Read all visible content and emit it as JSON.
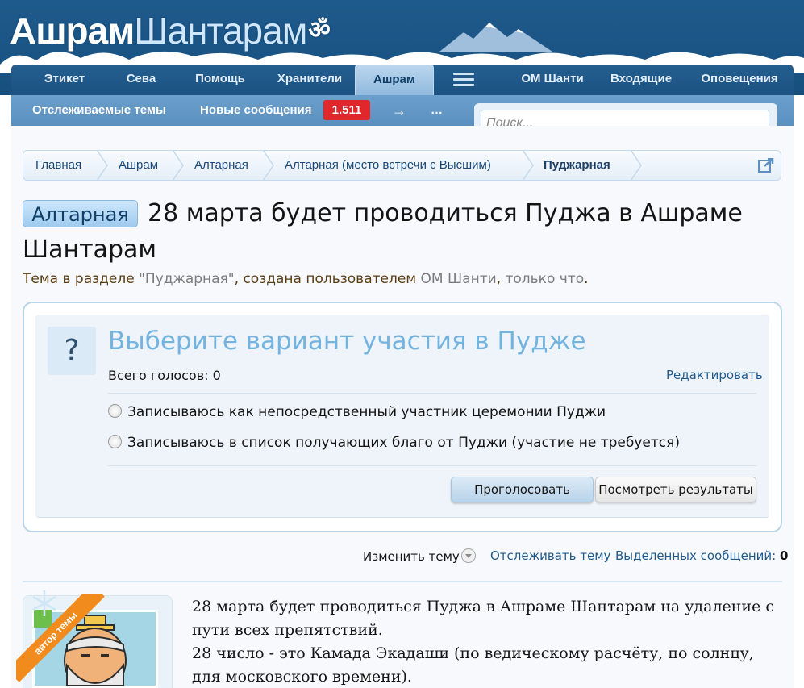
{
  "header": {
    "logo_part1": "Ашрам",
    "logo_part2": "Шантарам",
    "logo_symbol": "ॐ"
  },
  "nav": {
    "tabs": [
      {
        "label": "Этикет"
      },
      {
        "label": "Сева"
      },
      {
        "label": "Помощь"
      },
      {
        "label": "Хранители"
      },
      {
        "label": "Ашрам",
        "active": true
      },
      {
        "label": "ОМ Шанти"
      },
      {
        "label": "Входящие"
      },
      {
        "label": "Оповещения"
      }
    ],
    "menu_icon": "hamburger-menu-icon"
  },
  "subnav": {
    "watched": "Отслеживаемые темы",
    "new_posts": "Новые сообщения",
    "new_posts_count": "1.511",
    "arrow": "→",
    "more": "…"
  },
  "search": {
    "placeholder": "Поиск..."
  },
  "breadcrumb": {
    "items": [
      "Главная",
      "Ашрам",
      "Алтарная",
      "Алтарная (место встречи с Высшим)",
      "Пуджарная"
    ],
    "jump_icon": "external-jump-icon"
  },
  "thread": {
    "prefix": "Алтарная",
    "title": "28 марта будет проводиться Пуджа в Ашраме Шантарам",
    "meta_1": "Тема в разделе ",
    "meta_section": "\"Пуджарная\"",
    "meta_2": ", создана пользователем ",
    "meta_user": "ОМ Шанти",
    "meta_3": ", ",
    "meta_time": "только что",
    "meta_4": "."
  },
  "poll": {
    "icon": "?",
    "question": "Выберите вариант участия в Пудже",
    "total_label": "Всего голосов: 0",
    "edit_label": "Редактировать",
    "options": [
      "Записываюсь как непосредственный участник церемонии Пуджи",
      "Записываюсь в список получающих благо от Пуджи (участие не требуется)"
    ],
    "vote_button": "Проголосовать",
    "results_button": "Посмотреть результаты"
  },
  "tools": {
    "change_thread": "Изменить тему",
    "watch_thread": "Отслеживать тему",
    "selected_label": "Выделенных сообщений: ",
    "selected_count": "0"
  },
  "post": {
    "ribbon": "автор темы",
    "lines": [
      "28 марта будет проводиться Пуджа в Ашраме Шантарам на удаление с пути всех препятствий.",
      "28 число - это Камада Экадаши (по ведическому расчёту, по солнцу, для московского времени)."
    ]
  },
  "colors": {
    "header_bg": "#1f5a8c",
    "accent_blue": "#72b3e0",
    "badge_red": "#e0272b",
    "ribbon_orange": "#f28b1e"
  }
}
